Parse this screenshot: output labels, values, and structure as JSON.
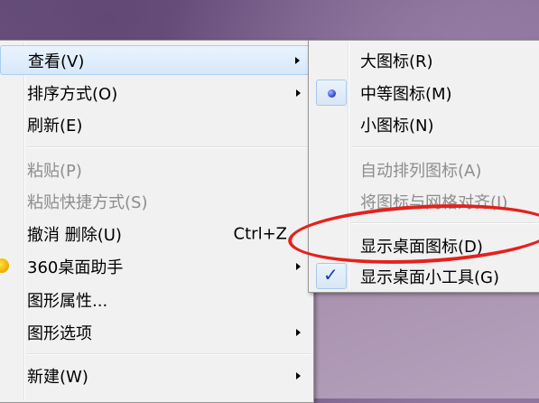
{
  "main_menu": {
    "items": [
      {
        "label": "查看(V)",
        "submenu": true,
        "highlight": true
      },
      {
        "label": "排序方式(O)",
        "submenu": true
      },
      {
        "label": "刷新(E)"
      },
      {
        "label": "粘贴(P)",
        "disabled": true
      },
      {
        "label": "粘贴快捷方式(S)",
        "disabled": true
      },
      {
        "label": "撤消 删除(U)",
        "shortcut": "Ctrl+Z"
      },
      {
        "label": "360桌面助手",
        "submenu": true,
        "icon": "360-assistant-icon"
      },
      {
        "label": "图形属性..."
      },
      {
        "label": "图形选项",
        "submenu": true
      },
      {
        "label": "新建(W)",
        "submenu": true
      }
    ]
  },
  "sub_menu": {
    "items": [
      {
        "label": "大图标(R)"
      },
      {
        "label": "中等图标(M)",
        "state": "radio-selected"
      },
      {
        "label": "小图标(N)"
      },
      {
        "label": "自动排列图标(A)",
        "disabled": true
      },
      {
        "label": "将图标与网格对齐(I)",
        "disabled": true
      },
      {
        "label": "显示桌面图标(D)",
        "annotated": true
      },
      {
        "label": "显示桌面小工具(G)",
        "state": "checked"
      }
    ]
  },
  "annotation": {
    "color": "#e4211c",
    "shape": "hand-drawn-oval"
  }
}
